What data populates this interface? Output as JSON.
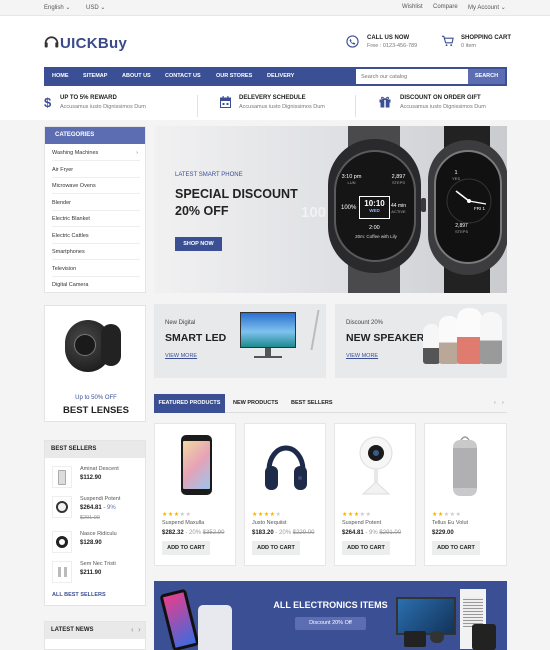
{
  "topbar": {
    "language": "English",
    "currency": "USD",
    "wishlist": "Wishlist",
    "compare": "Compare",
    "account": "My Account"
  },
  "header": {
    "logo": "UICKBuy",
    "call": {
      "title": "CALL US NOW",
      "sub": "Free : 0123-456-789"
    },
    "cart": {
      "title": "SHOPPING CART",
      "sub": "0 item"
    }
  },
  "nav": {
    "items": [
      "HOME",
      "SITEMAP",
      "ABOUT US",
      "CONTACT US",
      "OUR STORES",
      "DELIVERY"
    ],
    "search_placeholder": "Search our catalog",
    "search_button": "SEARCH"
  },
  "features": [
    {
      "title": "UP TO 5% REWARD",
      "sub": "Accusamus iusto Dignissimos Dum"
    },
    {
      "title": "DELEVERY SCHEDULE",
      "sub": "Accusamus iusto Dignissimos Dum"
    },
    {
      "title": "DISCOUNT ON ORDER GIFT",
      "sub": "Accusamus iusto Dignissimos Dum"
    }
  ],
  "categories": {
    "title": "CATEGORIES",
    "items": [
      "Washing Machines",
      "Air Fryer",
      "Microwave Ovens",
      "Blender",
      "Electric Blanket",
      "Electric Cattles",
      "Smartphones",
      "Television",
      "Digital Camera"
    ]
  },
  "hero": {
    "eyebrow": "LATEST SMART PHONE",
    "title1": "SPECIAL DISCOUNT",
    "title2": "20% OFF",
    "button": "SHOP NOW",
    "watch": {
      "time": "10:10",
      "day": "WED",
      "t1": "3:10 pm",
      "t1s": "LUN",
      "t2": "2,897",
      "t2s": "STEPS",
      "pct": "100%",
      "mins": "44 min",
      "mins_s": "ACTIVE",
      "cal": "2:00",
      "cal_s": "20m: Coffee with Lily",
      "fri": "FRI 1",
      "bg": "100",
      "r1": "1",
      "r1s": "YES",
      "r2": "2,897",
      "r2s": "STEPS"
    }
  },
  "lens_promo": {
    "off": "Up to 50% OFF",
    "title": "BEST LENSES"
  },
  "banners": [
    {
      "eyebrow": "New Digital",
      "title": "SMART LED",
      "link": "VIEW MORE"
    },
    {
      "eyebrow": "Discount 20%",
      "title": "NEW SPEAKER",
      "link": "VIEW MORE"
    }
  ],
  "tabs": [
    "FEATURED PRODUCTS",
    "NEW PRODUCTS",
    "BEST SELLERS"
  ],
  "products": [
    {
      "name": "Suspend Maxulla",
      "price": "$282.32",
      "disc": "- 20%",
      "old": "$352.90",
      "button": "ADD TO CART",
      "rating": 3
    },
    {
      "name": "Justo Nequiist",
      "price": "$183.20",
      "disc": "- 20%",
      "old": "$229.00",
      "button": "ADD TO CART",
      "rating": 4
    },
    {
      "name": "Suspend Potent",
      "price": "$264.81",
      "disc": "- 9%",
      "old": "$291.00",
      "button": "ADD TO CART",
      "rating": 3
    },
    {
      "name": "Tellus Eu Volut",
      "price": "$229.00",
      "disc": "",
      "old": "",
      "button": "ADD TO CART",
      "rating": 2
    }
  ],
  "best_sellers": {
    "title": "BEST SELLERS",
    "items": [
      {
        "name": "Aminat Descent",
        "price": "$112.90",
        "disc": "",
        "old": ""
      },
      {
        "name": "Suspendi Potent",
        "price": "$264.81",
        "disc": "- 9%",
        "old": "$291.00"
      },
      {
        "name": "Nasce Ridiculu",
        "price": "$128.90",
        "disc": "",
        "old": ""
      },
      {
        "name": "Sem Nec Tristi",
        "price": "$211.90",
        "disc": "",
        "old": ""
      }
    ],
    "all": "ALL BEST SELLERS"
  },
  "latest_news": {
    "title": "LATEST NEWS"
  },
  "promo": {
    "title": "ALL ELECTRONICS ITEMS",
    "badge": "Discount 20% Off"
  },
  "colors": {
    "primary": "#3b4f95",
    "accent": "#5c6db2",
    "star": "#f4b400"
  }
}
